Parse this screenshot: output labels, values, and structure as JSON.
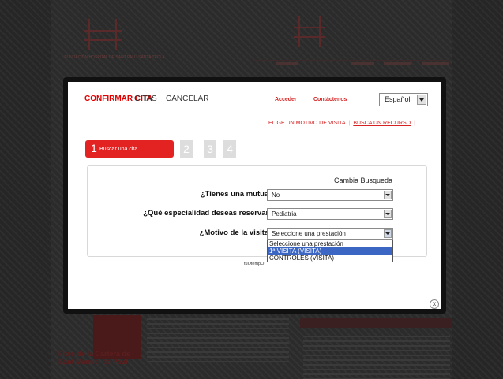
{
  "background": {
    "logo_caption": "FUNDACIÓN HOSPITAL DE SANT PAU I SANTA TECLA",
    "promo_text": "Fites de la Cartera de Sant Manuel de Paul"
  },
  "header": {
    "tabs": [
      "CONFIRMAR CITA",
      "CITAS",
      "CANCELAR"
    ],
    "links": [
      "Acceder",
      "Contáctenos"
    ],
    "language": "Español"
  },
  "subnav": {
    "link_1": "ELIGE UN MOTIVO DE VISITA",
    "link_2": "BUSCA UN RECURSO"
  },
  "steps": {
    "active_number": "1",
    "active_label": "Buscar una cita",
    "others": [
      "2",
      "3",
      "4"
    ]
  },
  "form": {
    "cambia_link": "Cambia Busqueda",
    "fields": [
      {
        "label": "¿Tienes una mutua?",
        "value": "No"
      },
      {
        "label": "¿Qué especialidad deseas reservar?",
        "value": "Pediatria"
      },
      {
        "label": "¿Motivo de la visita?",
        "value": "Seleccione una prestación"
      }
    ],
    "dropdown_options": [
      "Seleccione una prestación",
      "1ª VISITA (VISITA)",
      "CONTROLES (VISITA)"
    ],
    "highlighted_option": "1ª VISITA (VISITA)"
  },
  "powered_by": "tuOtempO",
  "close_label": "x",
  "colors": {
    "accent": "#e32222",
    "link": "#d62222",
    "highlight": "#3b66c4"
  },
  "icons": {
    "select_arrow": "chevron-down-icon",
    "close": "close-icon"
  }
}
